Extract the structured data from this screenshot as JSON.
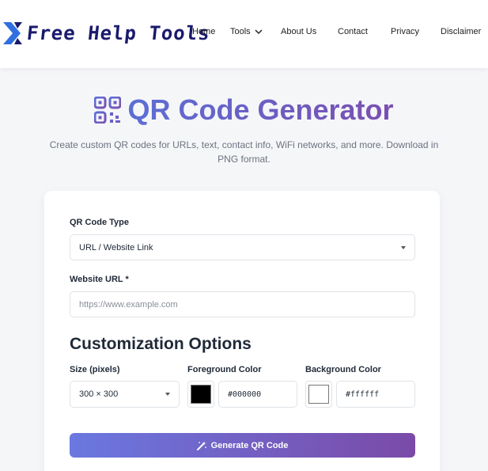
{
  "brand": {
    "name": "Free Help Tools"
  },
  "nav": {
    "items": [
      {
        "label": "Home"
      },
      {
        "label": "Tools"
      },
      {
        "label": "About Us"
      },
      {
        "label": "Contact"
      },
      {
        "label": "Privacy"
      },
      {
        "label": "Disclaimer"
      }
    ]
  },
  "hero": {
    "title": "QR Code Generator",
    "subtitle": "Create custom QR codes for URLs, text, contact info, WiFi networks, and more. Download in PNG format.",
    "icon": "qrcode-icon"
  },
  "form": {
    "type_label": "QR Code Type",
    "type_value": "URL / Website Link",
    "url_label": "Website URL *",
    "url_placeholder": "https://www.example.com",
    "custom_title": "Customization Options",
    "size_label": "Size (pixels)",
    "size_value": "300 × 300",
    "fg_label": "Foreground Color",
    "fg_value": "#000000",
    "bg_label": "Background Color",
    "bg_value": "#ffffff",
    "generate_label": "Generate QR Code"
  },
  "colors": {
    "accent_start": "#6a78e0",
    "accent_end": "#7b4aa8",
    "logo_blue": "#2f6fe0",
    "logo_navy": "#1a1a6e"
  }
}
